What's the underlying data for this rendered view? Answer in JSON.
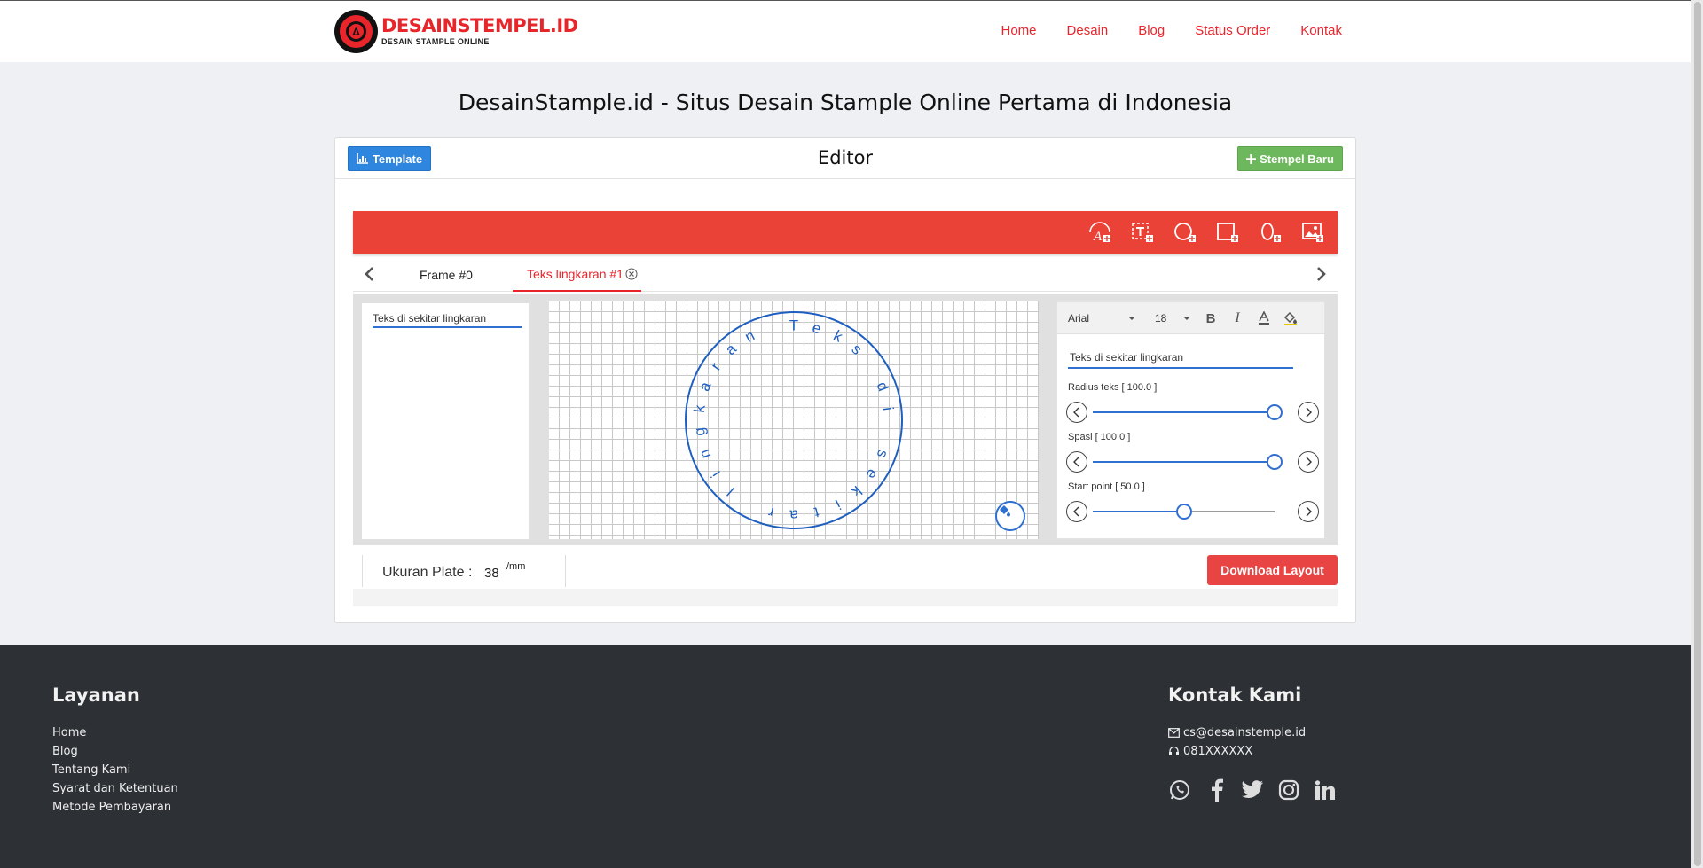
{
  "header": {
    "logo": {
      "title": "DESAINSTEMPEL.ID",
      "subtitle": "DESAIN STAMPLE ONLINE"
    },
    "nav": [
      "Home",
      "Desain",
      "Blog",
      "Status Order",
      "Kontak"
    ]
  },
  "page_title": "DesainStample.id - Situs Desain Stample Online Pertama di Indonesia",
  "editor": {
    "title": "Editor",
    "template_button": "Template",
    "new_stamp_button": "Stempel Baru",
    "toolbar_icons": [
      "text-arc-add-icon",
      "text-box-add-icon",
      "circle-add-icon",
      "rectangle-add-icon",
      "ellipse-add-icon",
      "image-add-icon"
    ],
    "tabs": [
      {
        "label": "Frame #0",
        "active": false
      },
      {
        "label": "Teks lingkaran #1",
        "active": true
      }
    ],
    "layers": [
      "Teks di sekitar lingkaran"
    ],
    "canvas_text": "Teks di sekitar lingkaran",
    "properties": {
      "font": "Arial",
      "size": "18",
      "text_value": "Teks di sekitar lingkaran",
      "sliders": [
        {
          "label": "Radius teks [ 100.0 ]",
          "level": 1.0
        },
        {
          "label": "Spasi [ 100.0 ]",
          "level": 1.0
        },
        {
          "label": "Start point [ 50.0 ]",
          "level": 0.5
        }
      ]
    },
    "plate": {
      "label": "Ukuran Plate :",
      "value": "38",
      "unit": "/mm"
    },
    "download_button": "Download Layout"
  },
  "footer": {
    "services": {
      "heading": "Layanan",
      "links": [
        "Home",
        "Blog",
        "Tentang Kami",
        "Syarat dan Ketentuan",
        "Metode Pembayaran"
      ]
    },
    "contact": {
      "heading": "Kontak Kami",
      "email": "cs@desainstemple.id",
      "phone": "081XXXXXX",
      "socials": [
        "whatsapp-icon",
        "facebook-icon",
        "twitter-icon",
        "instagram-icon",
        "linkedin-icon"
      ]
    }
  },
  "colors": {
    "accent": "#e8252b",
    "primary": "#2e86de",
    "success": "#6db85c",
    "canvas_stroke": "#1f5fbf",
    "footer": "#2d3035"
  }
}
